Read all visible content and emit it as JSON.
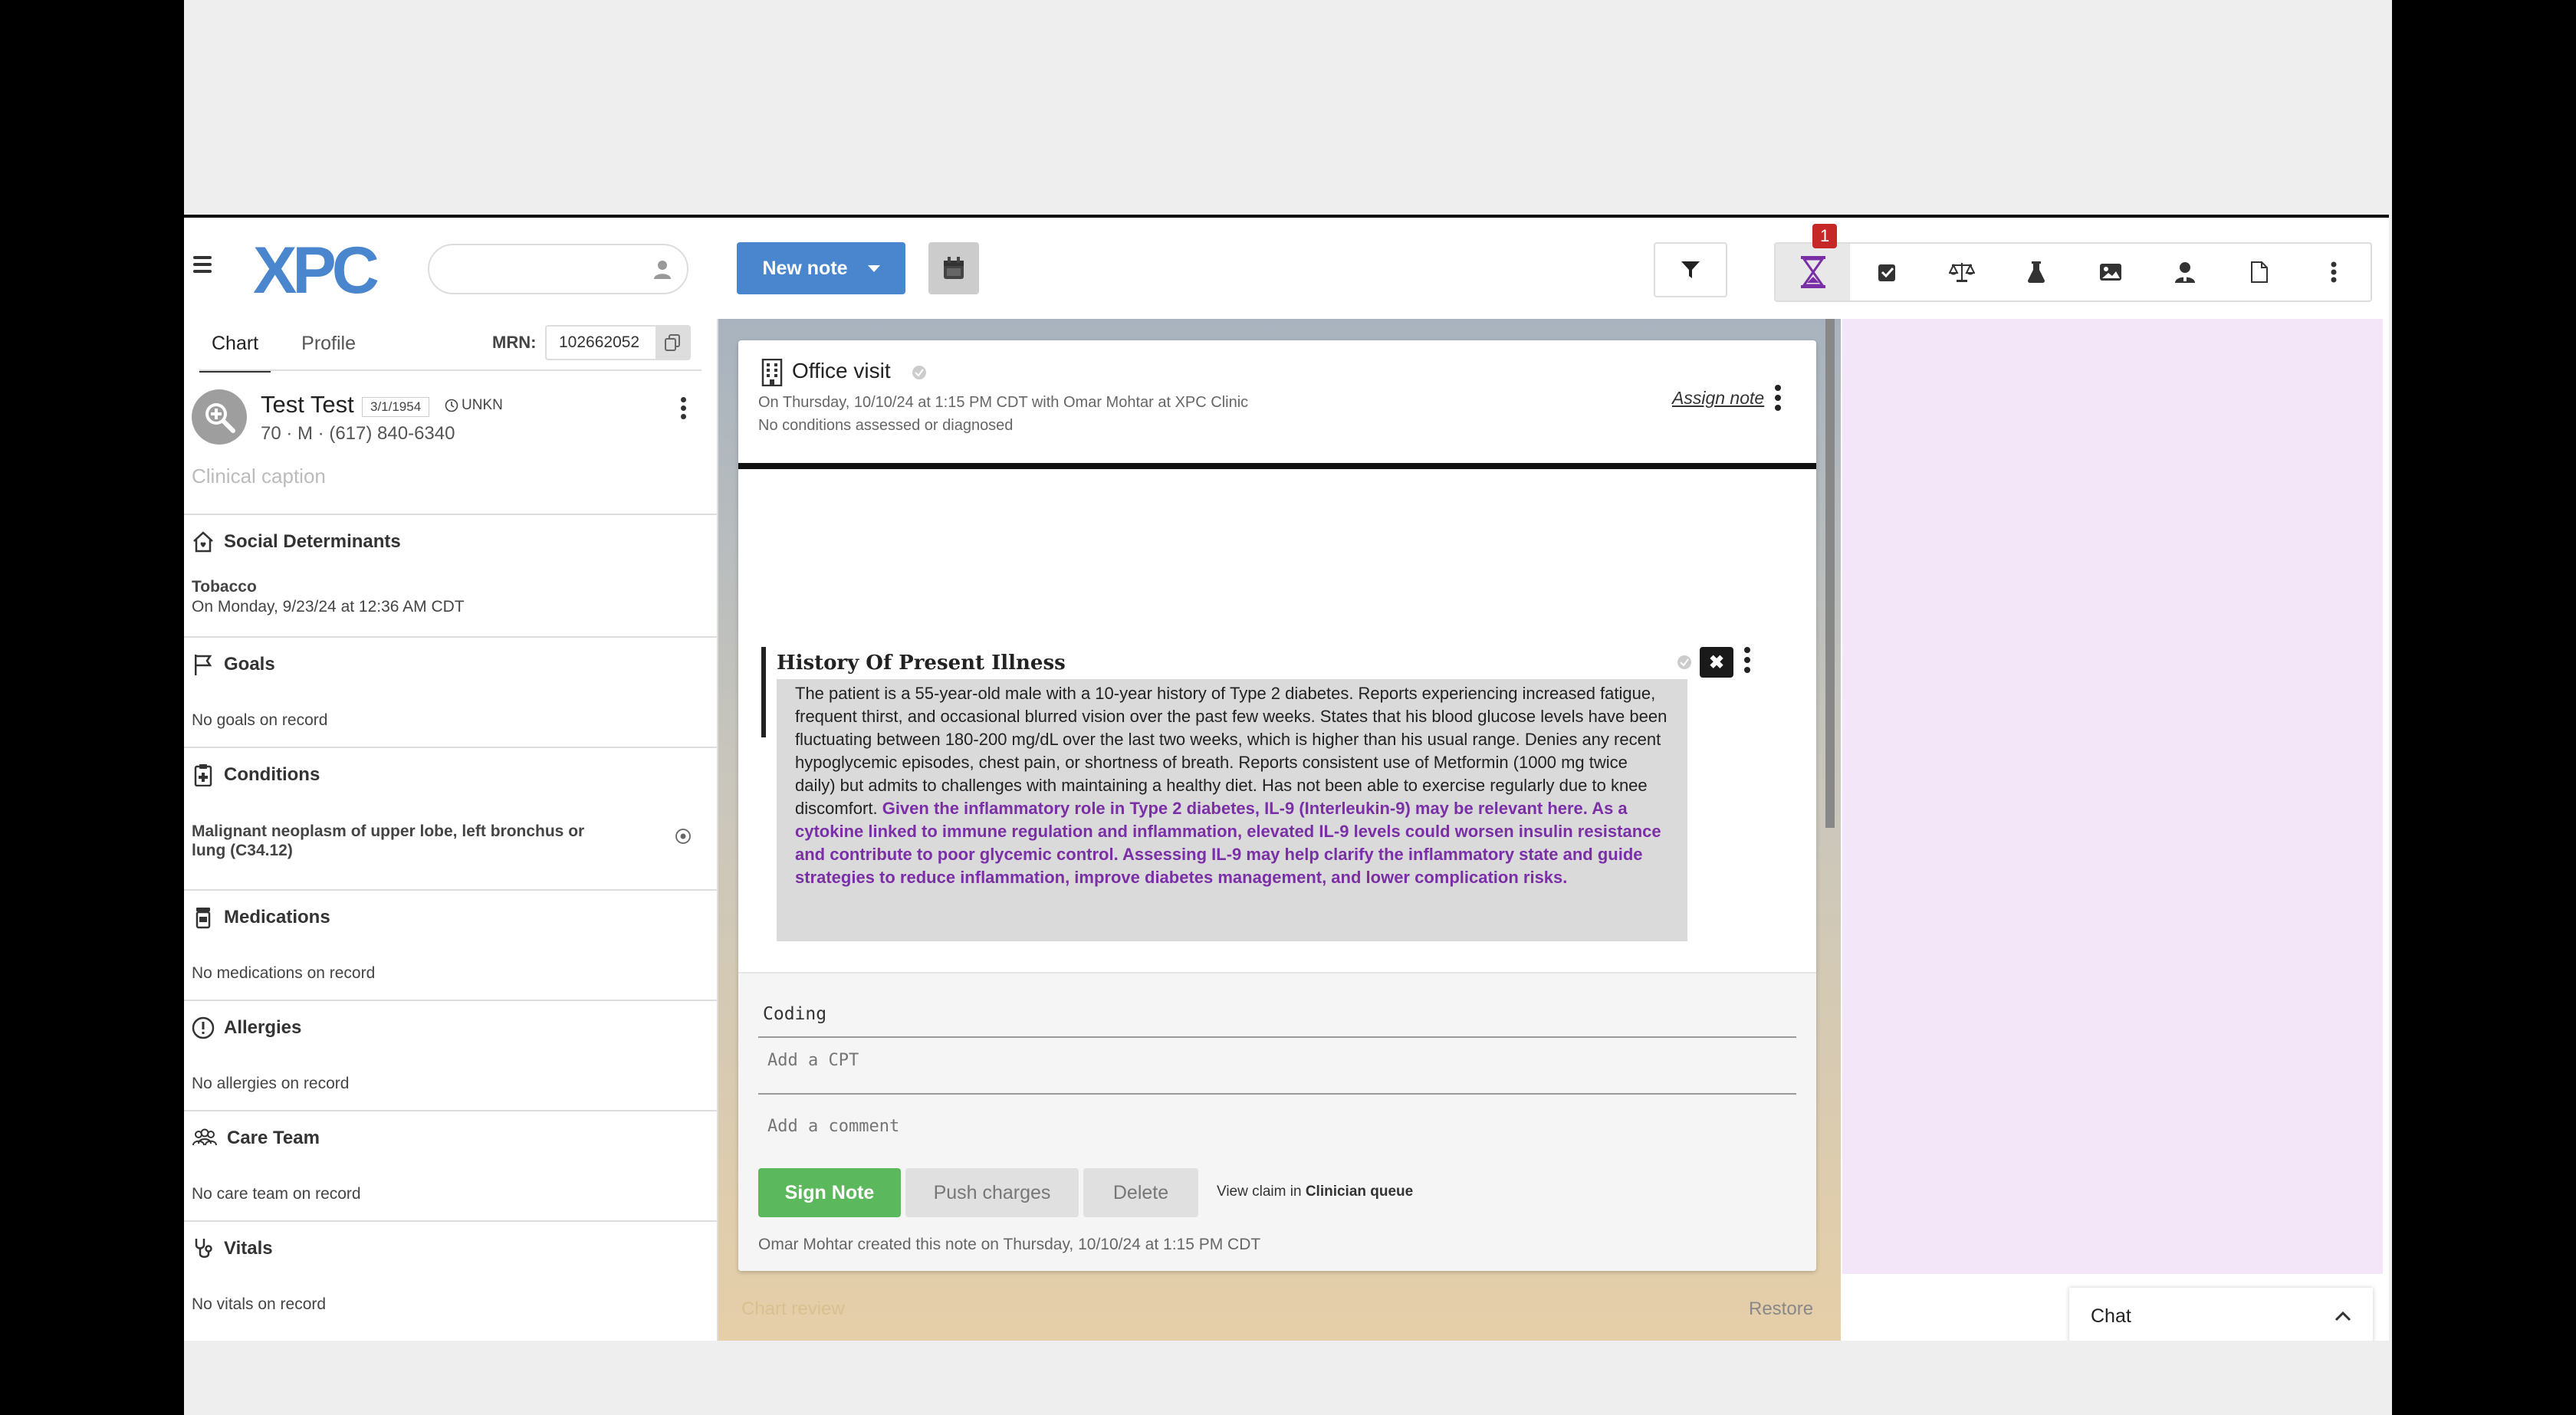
{
  "header": {
    "logo_text": "XPC",
    "search_placeholder": "",
    "new_note_label": "New note",
    "notification_count": "1",
    "toolbar_icons": [
      "hourglass-icon",
      "checkbox-icon",
      "scale-icon",
      "flask-icon",
      "image-icon",
      "user-doctor-icon",
      "document-icon",
      "more-vertical-icon"
    ]
  },
  "left": {
    "tabs": [
      {
        "label": "Chart"
      },
      {
        "label": "Profile"
      }
    ],
    "mrn_label": "MRN:",
    "mrn_value": "102662052",
    "patient": {
      "name": "Test Test",
      "dob": "3/1/1954",
      "status": "UNKN",
      "info": "70 · M · (617) 840-6340"
    },
    "caption": "Clinical caption",
    "sections": {
      "social": {
        "title": "Social Determinants",
        "item_title": "Tobacco",
        "item_sub": "On Monday, 9/23/24 at 12:36 AM CDT"
      },
      "goals": {
        "title": "Goals",
        "content": "No goals on record"
      },
      "conditions": {
        "title": "Conditions",
        "content": "Malignant neoplasm of upper lobe, left bronchus or lung (C34.12)"
      },
      "medications": {
        "title": "Medications",
        "content": "No medications on record"
      },
      "allergies": {
        "title": "Allergies",
        "content": "No allergies on record"
      },
      "care_team": {
        "title": "Care Team",
        "content": "No care team on record"
      },
      "vitals": {
        "title": "Vitals",
        "content": "No vitals on record"
      }
    }
  },
  "note": {
    "title": "Office visit",
    "subtitle": "On Thursday, 10/10/24 at 1:15 PM CDT with Omar Mohtar at XPC Clinic",
    "conditions": "No conditions assessed or diagnosed",
    "assign_label": "Assign note",
    "hpi": {
      "title": "History Of Present Illness",
      "text": "The patient is a 55-year-old male with a 10-year history of Type 2 diabetes. Reports experiencing increased fatigue, frequent thirst, and occasional blurred vision over the past few weeks. States that his blood glucose levels have been fluctuating between 180-200 mg/dL over the last two weeks, which is higher than his usual range. Denies any recent hypoglycemic episodes, chest pain, or shortness of breath. Reports consistent use of Metformin (1000 mg twice daily) but admits to challenges with maintaining a healthy diet. Has not been able to exercise regularly due to knee discomfort. ",
      "highlight": "Given the inflammatory role in Type 2 diabetes, IL-9 (Interleukin-9) may be relevant here. As a cytokine linked to immune regulation and inflammation, elevated IL-9 levels could worsen insulin resistance and contribute to poor glycemic control. Assessing IL-9 may help clarify the inflammatory state and guide strategies to reduce inflammation, improve diabetes management, and lower complication risks."
    },
    "coding_label": "Coding",
    "cpt_placeholder": "Add a CPT",
    "comment_placeholder": "Add a comment",
    "sign_label": "Sign Note",
    "push_label": "Push charges",
    "delete_label": "Delete",
    "claim_prefix": "View claim in ",
    "claim_link": "Clinician queue",
    "created": "Omar Mohtar created this note on Thursday, 10/10/24 at 1:15 PM CDT"
  },
  "footer": {
    "chart_review": "Chart review",
    "restore": "Restore"
  },
  "chat": {
    "label": "Chat"
  },
  "colors": {
    "primary": "#4a86cd",
    "success": "#5cb85c",
    "ai_text": "#7b2fa6",
    "badge": "#c62828",
    "panel_pink": "#f4e6f9"
  }
}
